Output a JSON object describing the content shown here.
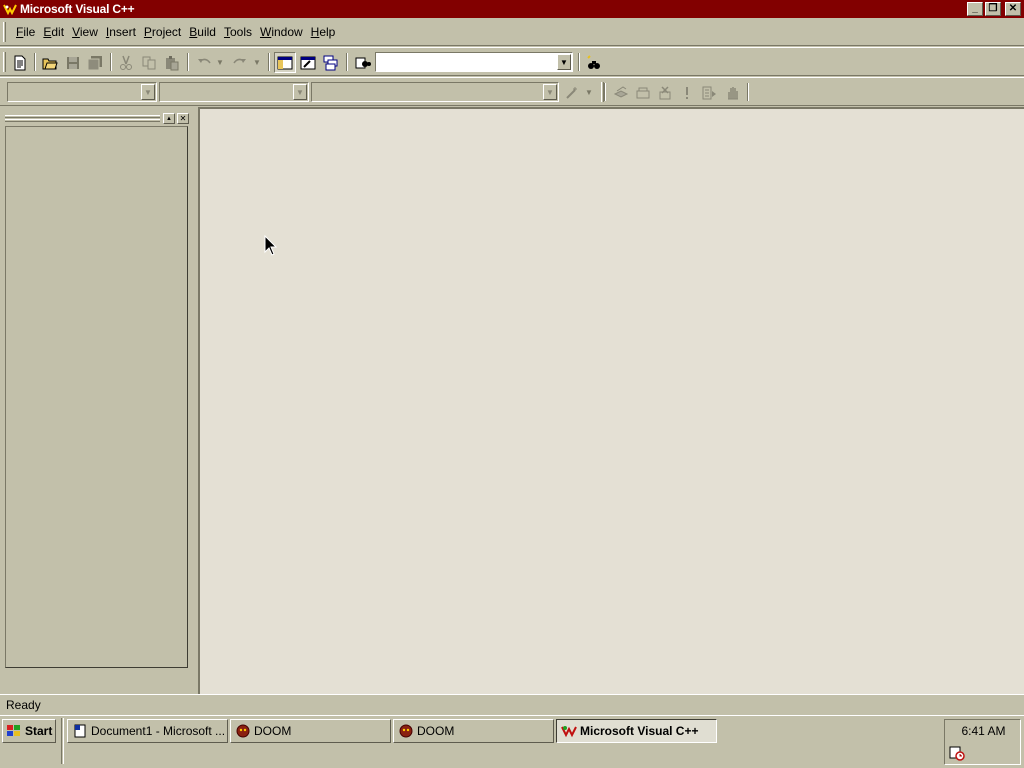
{
  "window": {
    "title": "Microsoft Visual C++",
    "controls": {
      "minimize": "_",
      "maximize": "❐",
      "close": "✕"
    }
  },
  "menu": [
    {
      "pre": "",
      "key": "F",
      "post": "ile"
    },
    {
      "pre": "",
      "key": "E",
      "post": "dit"
    },
    {
      "pre": "",
      "key": "V",
      "post": "iew"
    },
    {
      "pre": "",
      "key": "I",
      "post": "nsert"
    },
    {
      "pre": "",
      "key": "P",
      "post": "roject"
    },
    {
      "pre": "",
      "key": "B",
      "post": "uild"
    },
    {
      "pre": "",
      "key": "T",
      "post": "ools"
    },
    {
      "pre": "",
      "key": "W",
      "post": "indow"
    },
    {
      "pre": "",
      "key": "H",
      "post": "elp"
    }
  ],
  "toolbar": {
    "find_combo_value": "",
    "class_combo_value": "",
    "member_combo_value": "",
    "function_combo_value": ""
  },
  "workspace": {
    "restore_glyph": "▲",
    "close_glyph": "✕"
  },
  "status": {
    "text": "Ready"
  },
  "taskbar": {
    "start_label": "Start",
    "tasks": [
      {
        "label": "Document1 - Microsoft ...",
        "icon": "word-document-icon",
        "active": false
      },
      {
        "label": "DOOM",
        "icon": "doom-icon",
        "active": false
      },
      {
        "label": "DOOM",
        "icon": "doom-icon",
        "active": false
      },
      {
        "label": "Microsoft Visual C++",
        "icon": "visual-cpp-icon",
        "active": true
      }
    ],
    "clock": "6:41 AM",
    "tray_icon": "scheduler-icon"
  },
  "colors": {
    "titlebar": "#820000",
    "face": "#c2c0aa",
    "mdi_background": "#e4e0d4"
  }
}
